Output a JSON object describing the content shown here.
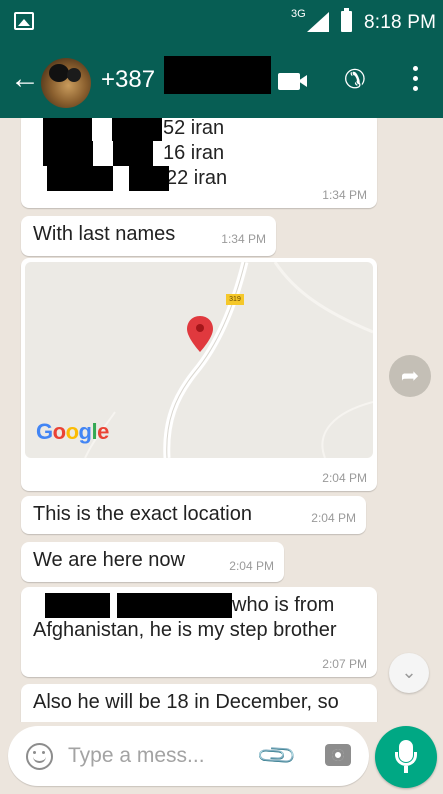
{
  "status_bar": {
    "network": "3G",
    "time": "8:18 PM"
  },
  "header": {
    "contact_name": "+387"
  },
  "messages": {
    "m1": {
      "line1": "52 iran",
      "line2": "16 iran",
      "line3": "22 iran",
      "time": "1:34 PM"
    },
    "m2": {
      "text": "With last names",
      "time": "1:34 PM"
    },
    "m3": {
      "map_logo": "Google",
      "road_badge": "319",
      "time": "2:04 PM"
    },
    "m4": {
      "text": "This is the exact location",
      "time": "2:04 PM"
    },
    "m5": {
      "text": "We are here now",
      "time": "2:04 PM"
    },
    "m6": {
      "line1": "who is from",
      "line2": "Afghanistan, he is my step brother",
      "time": "2:07 PM"
    },
    "m7": {
      "text": "Also he will be 18 in December, so"
    }
  },
  "composer": {
    "placeholder": "Type a mess..."
  },
  "colors": {
    "header": "#075e54",
    "chat_bg": "#ece5dd",
    "fab": "#00a884",
    "pin": "#e0393e"
  }
}
